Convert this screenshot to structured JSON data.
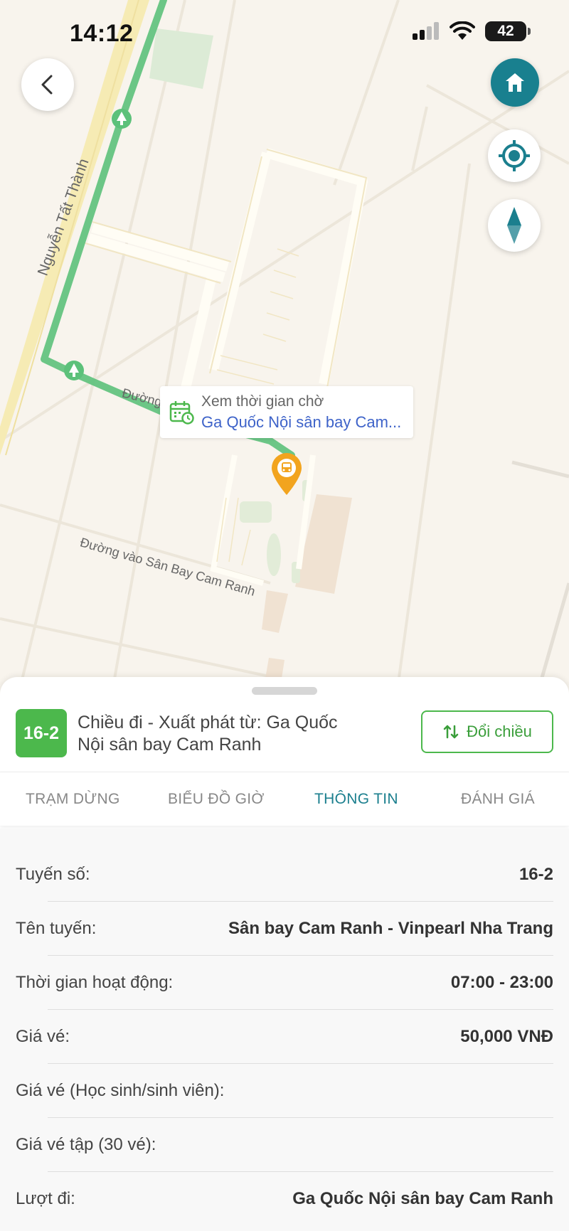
{
  "status_bar": {
    "time": "14:12",
    "battery": "42"
  },
  "map": {
    "road_nguyen_tat_thanh": "Nguyễn Tất Thành",
    "road_duong_short": "Đường",
    "road_vao_san_bay": "Đường vào Sân Bay Cam Ranh",
    "callout": {
      "title": "Xem thời gian chờ",
      "stop_name": "Ga Quốc Nội sân bay Cam..."
    },
    "colors": {
      "route": "#5cc17a",
      "road": "#f3e6a6",
      "pin": "#f2a41e"
    }
  },
  "route": {
    "number": "16-2",
    "direction": "Chiều đi - Xuất phát từ: Ga Quốc Nội sân bay Cam Ranh",
    "swap_label": "Đổi chiều"
  },
  "tabs": [
    {
      "label": "TRẠM DỪNG"
    },
    {
      "label": "BIỂU ĐỒ GIỜ"
    },
    {
      "label": "THÔNG TIN"
    },
    {
      "label": "ĐÁNH GIÁ"
    }
  ],
  "active_tab": "THÔNG TIN",
  "info": [
    {
      "label": "Tuyến số:",
      "value": "16-2"
    },
    {
      "label": "Tên tuyến:",
      "value": "Sân bay Cam Ranh - Vinpearl Nha Trang"
    },
    {
      "label": "Thời gian hoạt động:",
      "value": "07:00 - 23:00"
    },
    {
      "label": "Giá vé:",
      "value": "50,000 VNĐ"
    },
    {
      "label": "Giá vé (Học sinh/sinh viên):",
      "value": ""
    },
    {
      "label": "Giá vé tập (30 vé):",
      "value": ""
    },
    {
      "label": "Lượt đi:",
      "value": "Ga Quốc Nội sân bay Cam Ranh"
    }
  ]
}
